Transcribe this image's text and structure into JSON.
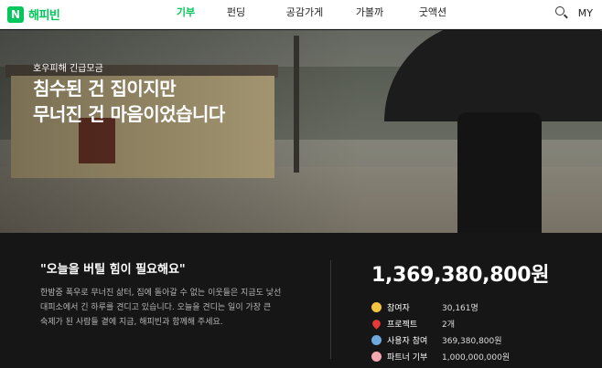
{
  "header": {
    "logo_letter": "N",
    "logo_text": "해피빈",
    "nav": [
      "기부",
      "펀딩",
      "공감가게",
      "가볼까",
      "굿액션"
    ],
    "my_label": "MY"
  },
  "hero": {
    "tag": "호우피해 긴급모금",
    "title_line1": "침수된 건 집이지만",
    "title_line2": "무너진 건 마음이었습니다"
  },
  "campaign": {
    "quote": "\"오늘을 버틸 힘이 필요해요\"",
    "desc_line1": "한밤중 폭우로 무너진 삶터, 집에 돌아갈 수 없는 이웃들은 지금도 낯선",
    "desc_line2": "대피소에서 긴 하루를 견디고 있습니다. 오늘을 견디는 일이 가장 큰",
    "desc_line3": "숙제가 된 사람들 곁에 지금, 해피빈과 함께해 주세요.",
    "total": "1,369,380,800원",
    "stats": [
      {
        "icon": "smile-icon",
        "label": "참여자",
        "value": "30,161명"
      },
      {
        "icon": "heart-icon",
        "label": "프로젝트",
        "value": "2개"
      },
      {
        "icon": "user-icon",
        "label": "사용자 참여",
        "value": "369,380,800원"
      },
      {
        "icon": "hand-icon",
        "label": "파트너 기부",
        "value": "1,000,000,000원"
      }
    ]
  },
  "colors": {
    "brand": "#03c75a",
    "bg_dark": "#161616"
  }
}
